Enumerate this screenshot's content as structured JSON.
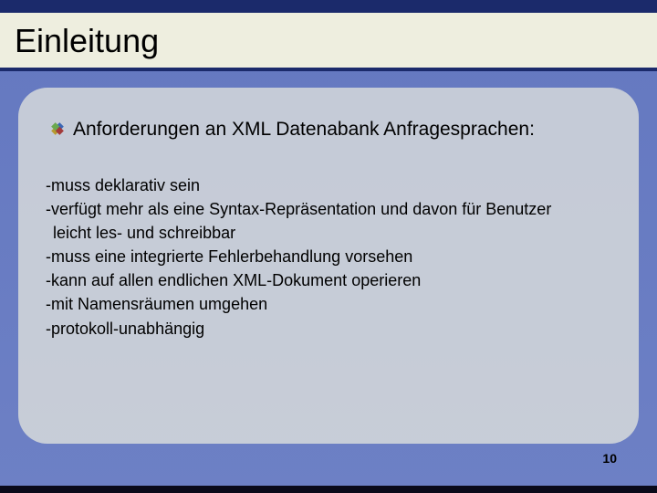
{
  "title": "Einleitung",
  "intro": "Anforderungen an XML Datenabank Anfragesprachen:",
  "requirements": {
    "r1": "-muss deklarativ sein",
    "r2": "-verfügt mehr als eine Syntax-Repräsentation und davon für Benutzer",
    "r2b": " leicht les- und schreibbar",
    "r3": "-muss eine integrierte Fehlerbehandlung vorsehen",
    "r4": "-kann auf allen endlichen XML-Dokument operieren",
    "r5": "-mit Namensräumen umgehen",
    "r6": "-protokoll-unabhängig"
  },
  "page_number": "10",
  "icons": {
    "bullet": "diamond-quad-icon"
  }
}
